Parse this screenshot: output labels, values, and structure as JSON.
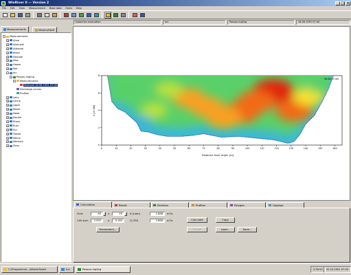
{
  "window": {
    "title": "WinRiver II  —  Version 2",
    "minimize": "_",
    "maximize": "□",
    "close": "×"
  },
  "menu": [
    "File",
    "Edit",
    "View",
    "Measurement",
    "Base data",
    "Extra",
    "Help"
  ],
  "toolbar": {
    "buttons": [
      {
        "name": "new",
        "color": "#f4f4f4"
      },
      {
        "name": "open",
        "color": "#e6c34a"
      },
      {
        "name": "save",
        "color": "#3d5fa8"
      },
      {
        "name": "print",
        "color": "#9c9c9c"
      },
      {
        "name": "cut",
        "color": "#7a7a7a"
      },
      {
        "name": "copy",
        "color": "#dcdcdc"
      },
      {
        "name": "paste",
        "color": "#c8a040"
      },
      {
        "name": "chart",
        "color": "#c0392b"
      },
      {
        "name": "table",
        "color": "#6a8fd0"
      },
      {
        "name": "calc",
        "color": "#4a9a4a"
      },
      {
        "name": "vertical",
        "color": "#3060c0"
      },
      {
        "name": "profile",
        "color": "#20a0a0"
      },
      {
        "name": "active-tool",
        "color": "#e8c020",
        "active": true
      },
      {
        "name": "map",
        "color": "#2a8a2a"
      },
      {
        "name": "settings",
        "color": "#888888"
      },
      {
        "name": "export",
        "color": "#d06060"
      },
      {
        "name": "help",
        "color": "#3050c0"
      }
    ]
  },
  "status_top": {
    "view": "Isotachen evaluation",
    "river": "Inn",
    "station": "Passau-Ingling",
    "datetime": "18.06.1991 07:40"
  },
  "left_tabs": [
    "Measurements",
    "Meters/Staff"
  ],
  "tree": [
    {
      "label": "Measurements",
      "level": 0,
      "exp": "-",
      "icon": "folder"
    },
    {
      "label": "Ahne",
      "level": 1,
      "exp": "+",
      "icon": "river"
    },
    {
      "label": "Altmuehl",
      "level": 1,
      "exp": "+",
      "icon": "river"
    },
    {
      "label": "Alzkanal",
      "level": 1,
      "exp": "+",
      "icon": "river"
    },
    {
      "label": "Biese",
      "level": 1,
      "exp": "+",
      "icon": "river"
    },
    {
      "label": "Danube",
      "level": 1,
      "exp": "+",
      "icon": "river"
    },
    {
      "label": "Elbe",
      "level": 1,
      "exp": "+",
      "icon": "river"
    },
    {
      "label": "Haase",
      "level": 1,
      "exp": "+",
      "icon": "river"
    },
    {
      "label": "Iller",
      "level": 1,
      "exp": "+",
      "icon": "river"
    },
    {
      "label": "Inn",
      "level": 1,
      "exp": "-",
      "icon": "river"
    },
    {
      "label": "Passau-Ingling",
      "level": 2,
      "exp": "-",
      "icon": "station"
    },
    {
      "label": "Measurements",
      "level": 3,
      "exp": "-",
      "icon": "folder"
    },
    {
      "label": "Multicell 18.06.1991 07:40",
      "level": 4,
      "exp": "",
      "icon": "meas",
      "selected": true
    },
    {
      "label": "Discharge curves",
      "level": 3,
      "exp": "",
      "icon": "curve"
    },
    {
      "label": "Profiles",
      "level": 3,
      "exp": "",
      "icon": "profile"
    },
    {
      "label": "Lahn",
      "level": 1,
      "exp": "+",
      "icon": "river"
    },
    {
      "label": "Lenne",
      "level": 1,
      "exp": "+",
      "icon": "river"
    },
    {
      "label": "Lippe",
      "level": 1,
      "exp": "+",
      "icon": "river"
    },
    {
      "label": "Mosel",
      "level": 1,
      "exp": "+",
      "icon": "river"
    },
    {
      "label": "Neab",
      "level": 1,
      "exp": "+",
      "icon": "river"
    },
    {
      "label": "Neckar",
      "level": 1,
      "exp": "+",
      "icon": "river"
    },
    {
      "label": "Rhein",
      "level": 1,
      "exp": "+",
      "icon": "river"
    },
    {
      "label": "Ruhr",
      "level": 1,
      "exp": "+",
      "icon": "river"
    },
    {
      "label": "Sur",
      "level": 1,
      "exp": "+",
      "icon": "river"
    },
    {
      "label": "Traisel",
      "level": 1,
      "exp": "+",
      "icon": "river"
    },
    {
      "label": "Werra",
      "level": 1,
      "exp": "+",
      "icon": "river"
    },
    {
      "label": "Wertach",
      "level": 1,
      "exp": "+",
      "icon": "river"
    },
    {
      "label": "Zenn",
      "level": 1,
      "exp": "+",
      "icon": "river"
    }
  ],
  "chart_data": {
    "type": "heatmap",
    "title": "",
    "xlabel": "Distance from origin [m]",
    "ylabel": "h [m üN]",
    "corner_label": "96.84 m üN",
    "xlim": [
      0,
      165
    ],
    "ylim": [
      0,
      8
    ],
    "xticks": [
      0,
      10,
      20,
      30,
      40,
      50,
      60,
      70,
      80,
      90,
      100,
      110,
      120,
      130,
      140,
      150,
      160
    ],
    "yticks": [
      0,
      2,
      4,
      6,
      8
    ],
    "grid": false,
    "riverbed": [
      [
        4,
        8
      ],
      [
        7,
        5
      ],
      [
        11,
        4.2
      ],
      [
        16,
        3.8
      ],
      [
        20,
        3.2
      ],
      [
        24,
        2.6
      ],
      [
        27,
        1.6
      ],
      [
        32,
        1.5
      ],
      [
        38,
        1.2
      ],
      [
        45,
        1.0
      ],
      [
        55,
        1.0
      ],
      [
        62,
        1.1
      ],
      [
        70,
        1.3
      ],
      [
        82,
        0.9
      ],
      [
        94,
        1.0
      ],
      [
        106,
        0.8
      ],
      [
        118,
        0.6
      ],
      [
        128,
        0.2
      ],
      [
        132,
        0.4
      ],
      [
        136,
        1.2
      ],
      [
        140,
        2.4
      ],
      [
        146,
        3.4
      ],
      [
        152,
        5.2
      ],
      [
        156,
        6.6
      ],
      [
        159,
        8
      ]
    ],
    "hotspots": [
      {
        "x": 118,
        "y": 6.2,
        "level": 1.0
      },
      {
        "x": 106,
        "y": 5.0,
        "level": 0.85
      },
      {
        "x": 96,
        "y": 3.8,
        "level": 0.8
      },
      {
        "x": 84,
        "y": 3.2,
        "level": 0.72
      },
      {
        "x": 72,
        "y": 4.4,
        "level": 0.68
      },
      {
        "x": 60,
        "y": 5.4,
        "level": 0.62
      },
      {
        "x": 132,
        "y": 4.0,
        "level": 0.82
      },
      {
        "x": 142,
        "y": 5.6,
        "level": 0.55
      },
      {
        "x": 46,
        "y": 6.4,
        "level": 0.4
      },
      {
        "x": 36,
        "y": 4.0,
        "level": 0.35
      },
      {
        "x": 20,
        "y": 6.6,
        "level": 0.3
      },
      {
        "x": 12,
        "y": 6.0,
        "level": 0.18
      },
      {
        "x": 28,
        "y": 2.6,
        "level": 0.05
      },
      {
        "x": 150,
        "y": 6.8,
        "level": 0.25
      }
    ]
  },
  "bottom_tabs": [
    "Calculation",
    "Result",
    "Sections",
    "Profiles",
    "Polygon",
    "Gagings"
  ],
  "calc": {
    "grid_label": "Grid:",
    "cellsize_label": "Cell size:",
    "x_label": "x",
    "grid_x": "80",
    "grid_y": "50",
    "cell_x": "2.092",
    "cell_y": "0.165",
    "a_label": "A (nom)",
    "a_val": "2.888",
    "a_unit": "m³/s",
    "q_label": "Q (FD)",
    "q_val": "2.888",
    "q_unit": "m³/s",
    "parameters": "Parameters...",
    "calculate": "Calculate",
    "cancel": "Cancel",
    "copy": "Copy",
    "load": "Load...",
    "save": "Save..."
  },
  "taskbar": {
    "start": "C:\\Programme...\\WinterSozib",
    "app": "Inn",
    "task": "Passau-Ingling",
    "time": "2:50:52",
    "date": "22.10.2001 07:40"
  }
}
